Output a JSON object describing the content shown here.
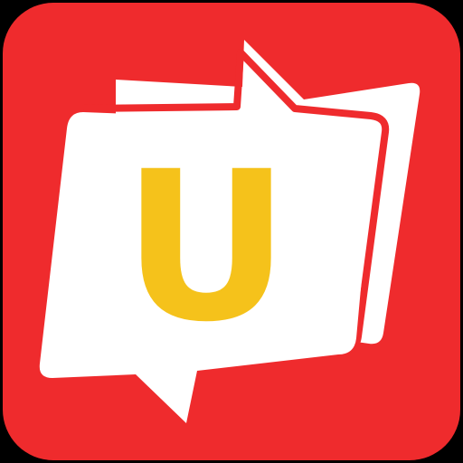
{
  "app_icon": {
    "logo_letter": "U",
    "colors": {
      "background": "#EF2B2D",
      "bubble": "#FFFFFF",
      "letter": "#F5C21B",
      "outer": "#000000"
    }
  }
}
